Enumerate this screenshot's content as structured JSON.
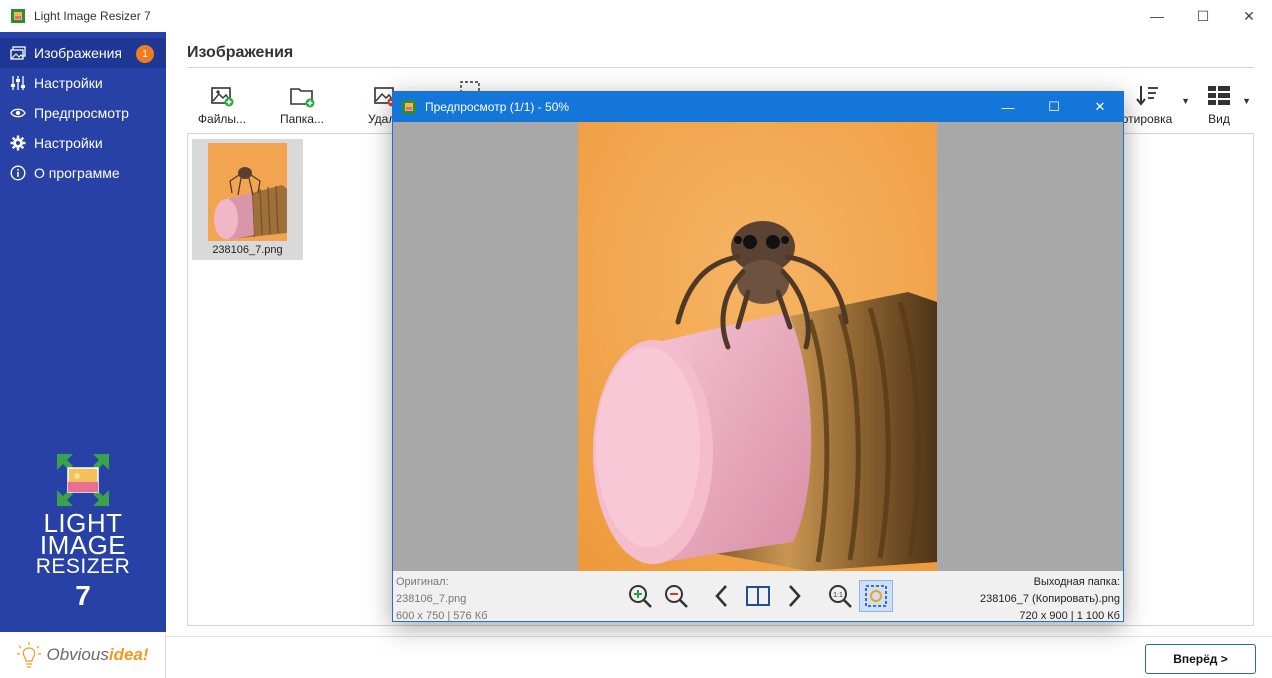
{
  "window": {
    "title": "Light Image Resizer 7",
    "controls": {
      "minimize": "—",
      "maximize": "☐",
      "close": "✕"
    }
  },
  "sidebar": {
    "items": [
      {
        "label": "Изображения",
        "icon": "images-icon",
        "badge": "1",
        "active": true
      },
      {
        "label": "Настройки",
        "icon": "sliders-icon"
      },
      {
        "label": "Предпросмотр",
        "icon": "eye-icon"
      },
      {
        "label": "Настройки",
        "icon": "gear-icon"
      },
      {
        "label": "О программе",
        "icon": "info-icon"
      }
    ],
    "logo": {
      "line1": "LIGHT",
      "line2": "IMAGE",
      "line3": "RESIZER",
      "version": "7"
    },
    "brand": {
      "prefix": "Obvious",
      "suffix": "idea!"
    }
  },
  "main": {
    "title": "Изображения",
    "toolbar": {
      "files": "Файлы...",
      "folder": "Папка...",
      "remove": "Удали",
      "sort": "ртировка",
      "view": "Вид"
    },
    "images": [
      {
        "filename": "238106_7.png"
      }
    ],
    "forward_button": "Вперёд >"
  },
  "preview": {
    "title": "Предпросмотр (1/1) - 50%",
    "original_label": "Оригинал:",
    "original_file": "238106_7.png",
    "original_info": "600 x 750  |  576 Кб",
    "output_label": "Выходная папка:",
    "output_file": "238106_7 (Копировать).png",
    "output_info": "720 x 900  |  1 100 Кб"
  },
  "colors": {
    "sidebar": "#2741a6",
    "accent": "#1476d8",
    "badge": "#f07c22",
    "image_bg": "#f3a24c"
  }
}
